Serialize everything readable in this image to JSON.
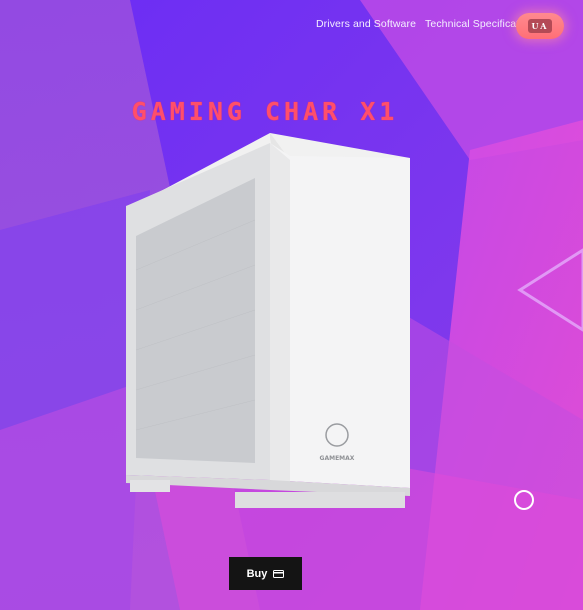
{
  "nav": {
    "links": [
      "Drivers and Software",
      "Technical Specification"
    ],
    "lang": "UA"
  },
  "hero": {
    "title": "GAMING CHAR X1"
  },
  "product": {
    "logo_text": "GAMEMAX"
  },
  "cta": {
    "buy_label": "Buy",
    "buy_icon": "credit-card-icon"
  },
  "colors": {
    "title": "#ff4f6a",
    "button": "#141414",
    "accent_pink": "#ff6f76"
  }
}
